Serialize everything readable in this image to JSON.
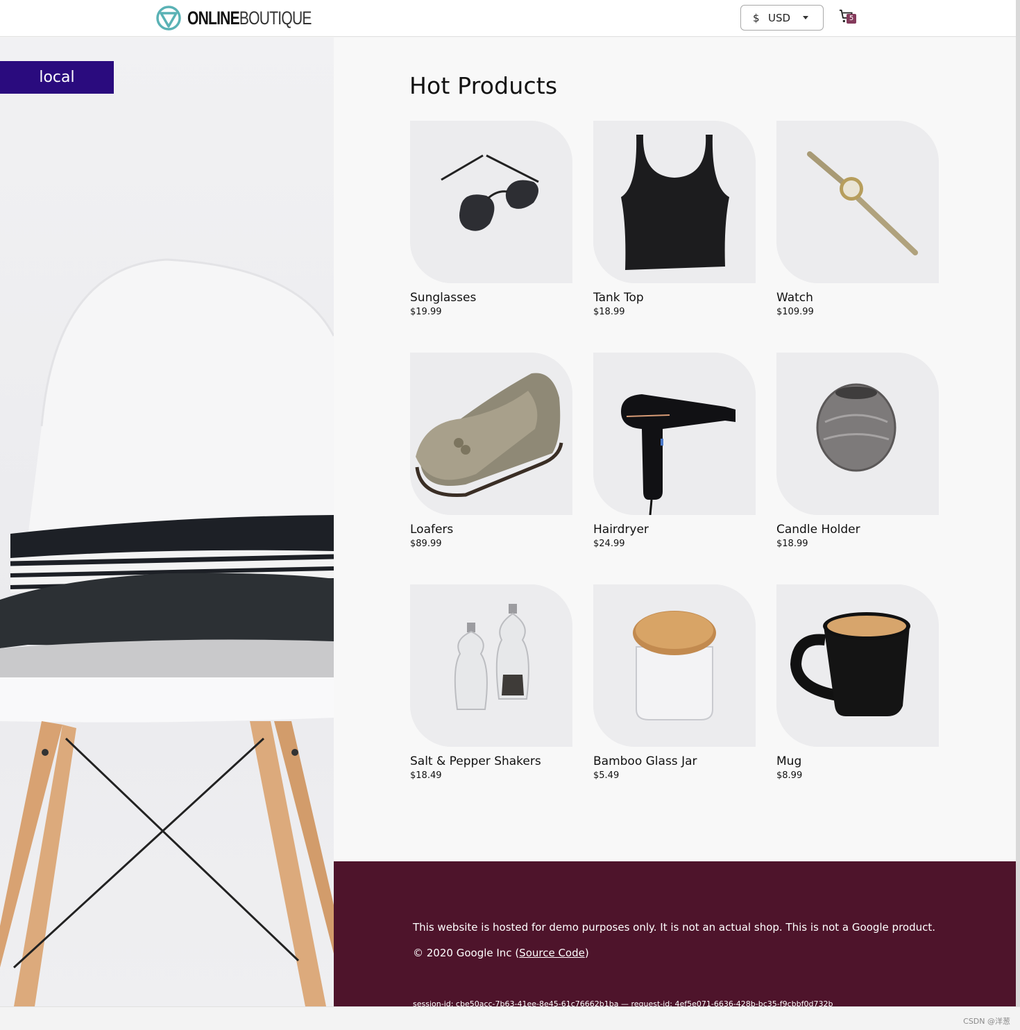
{
  "header": {
    "logo_bold": "ONLINE",
    "logo_light": "BOUTIQUE",
    "currency_symbol": "$",
    "currency_code": "USD",
    "cart_count": "5"
  },
  "hero": {
    "badge": "local"
  },
  "main": {
    "title": "Hot Products",
    "products": [
      {
        "name": "Sunglasses",
        "price": "$19.99",
        "icon": "sunglasses-image"
      },
      {
        "name": "Tank Top",
        "price": "$18.99",
        "icon": "tank-top-image"
      },
      {
        "name": "Watch",
        "price": "$109.99",
        "icon": "watch-image"
      },
      {
        "name": "Loafers",
        "price": "$89.99",
        "icon": "loafers-image"
      },
      {
        "name": "Hairdryer",
        "price": "$24.99",
        "icon": "hairdryer-image"
      },
      {
        "name": "Candle Holder",
        "price": "$18.99",
        "icon": "candle-holder-image"
      },
      {
        "name": "Salt & Pepper Shakers",
        "price": "$18.49",
        "icon": "salt-pepper-image"
      },
      {
        "name": "Bamboo Glass Jar",
        "price": "$5.49",
        "icon": "bamboo-jar-image"
      },
      {
        "name": "Mug",
        "price": "$8.99",
        "icon": "mug-image"
      }
    ]
  },
  "footer": {
    "note": "This website is hosted for demo purposes only. It is not an actual shop. This is not a Google product.",
    "copyright_prefix": "© 2020 Google Inc (",
    "source_link": "Source Code",
    "copyright_suffix": ")",
    "session": "session-id: cbe50acc-7b63-41ee-8e45-61c76662b1ba — request-id: 4ef5e071-6636-428b-bc35-f9cbbf0d732b"
  },
  "watermark": "CSDN @洋葱",
  "colors": {
    "header_bg": "#ffffff",
    "badge_bg": "#2a0b7e",
    "footer_bg": "#4e142b",
    "cart_badge": "#853b5c",
    "logo_teal": "#5ab2b5"
  }
}
